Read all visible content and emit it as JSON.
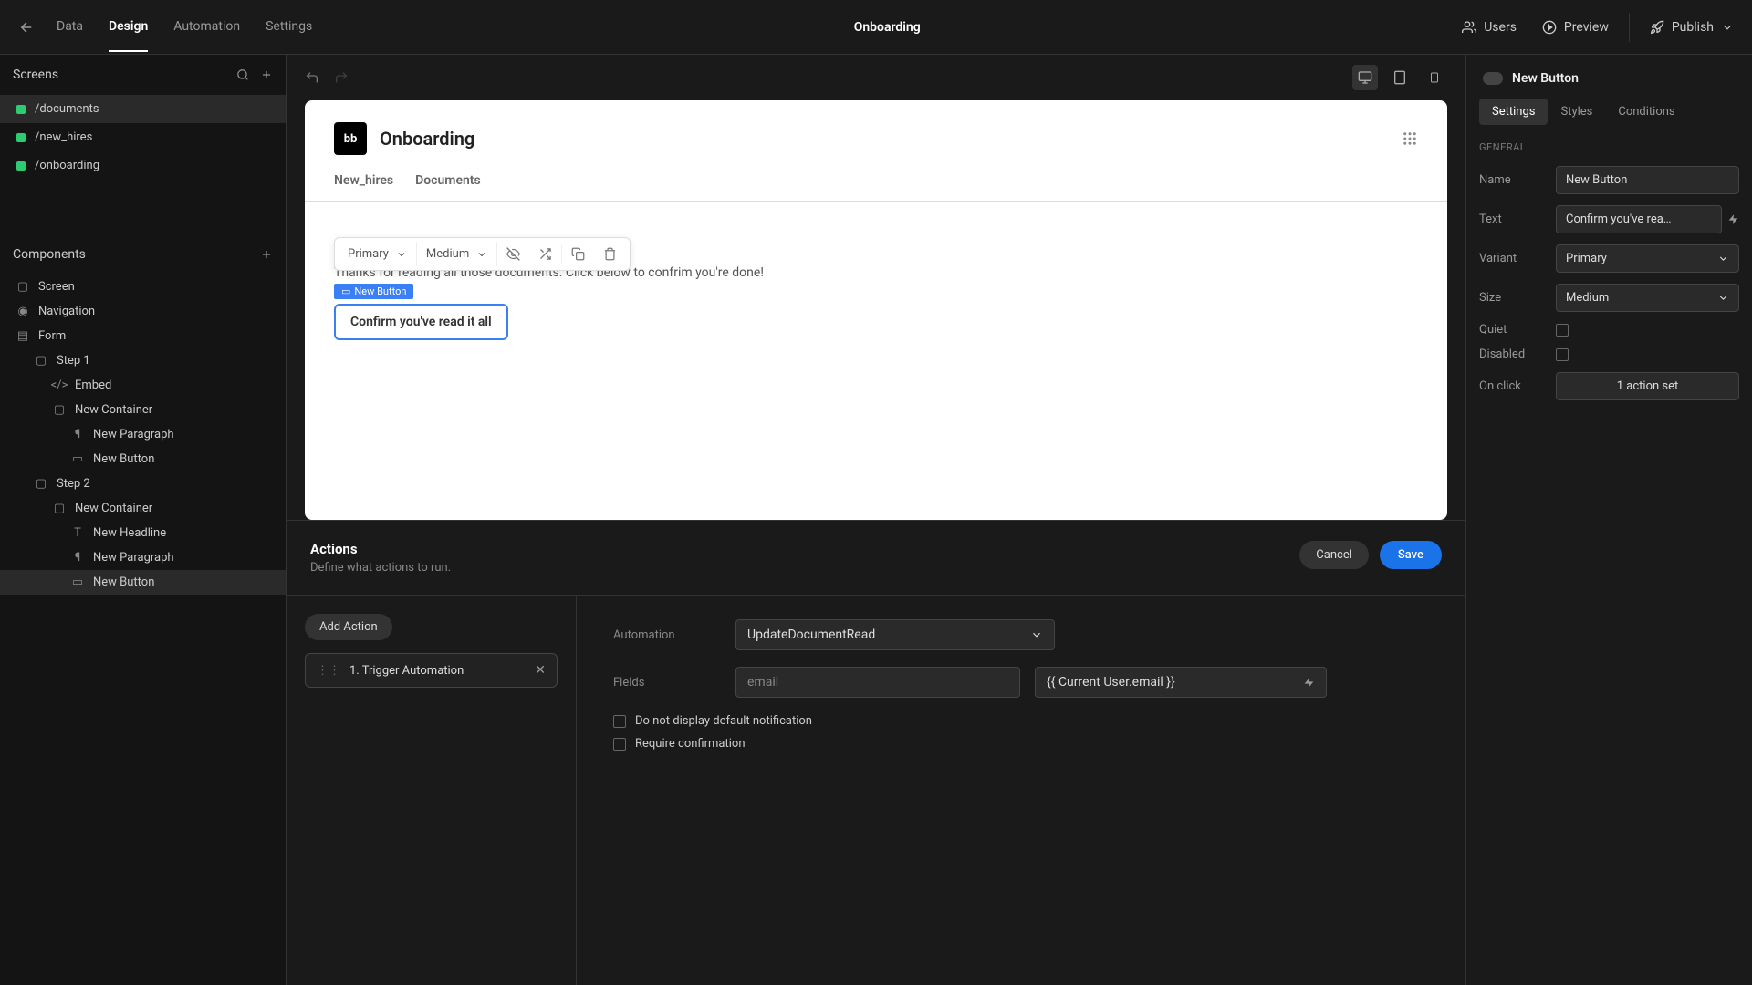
{
  "topbar": {
    "nav": {
      "data": "Data",
      "design": "Design",
      "automation": "Automation",
      "settings": "Settings"
    },
    "title": "Onboarding",
    "users": "Users",
    "preview": "Preview",
    "publish": "Publish"
  },
  "screens": {
    "header": "Screens",
    "items": [
      "/documents",
      "/new_hires",
      "/onboarding"
    ]
  },
  "components": {
    "header": "Components",
    "tree": {
      "screen": "Screen",
      "navigation": "Navigation",
      "form": "Form",
      "step1": "Step 1",
      "embed": "Embed",
      "container1": "New Container",
      "paragraph1": "New Paragraph",
      "button1": "New Button",
      "step2": "Step 2",
      "container2": "New Container",
      "headline": "New Headline",
      "paragraph2": "New Paragraph",
      "button2": "New Button"
    }
  },
  "canvas": {
    "title": "Onboarding",
    "nav_new_hires": "New_hires",
    "nav_documents": "Documents",
    "toolbar": {
      "variant": "Primary",
      "size": "Medium"
    },
    "body_text": "Thanks for reading all those documents. Click below to confrim you're done!",
    "selected_tag": "New Button",
    "confirm_btn": "Confirm you've read it all"
  },
  "actions": {
    "title": "Actions",
    "subtitle": "Define what actions to run.",
    "cancel": "Cancel",
    "save": "Save",
    "add_action": "Add Action",
    "action_item": "1. Trigger Automation",
    "automation_label": "Automation",
    "automation_value": "UpdateDocumentRead",
    "fields_label": "Fields",
    "field_name": "email",
    "field_value": "{{ Current User.email }}",
    "opt_no_notif": "Do not display default notification",
    "opt_require_confirm": "Require confirmation"
  },
  "right_panel": {
    "header": "New Button",
    "tabs": {
      "settings": "Settings",
      "styles": "Styles",
      "conditions": "Conditions"
    },
    "section_general": "GENERAL",
    "name_label": "Name",
    "name_value": "New Button",
    "text_label": "Text",
    "text_value": "Confirm you've rea…",
    "variant_label": "Variant",
    "variant_value": "Primary",
    "size_label": "Size",
    "size_value": "Medium",
    "quiet_label": "Quiet",
    "disabled_label": "Disabled",
    "onclick_label": "On click",
    "onclick_value": "1 action set"
  }
}
